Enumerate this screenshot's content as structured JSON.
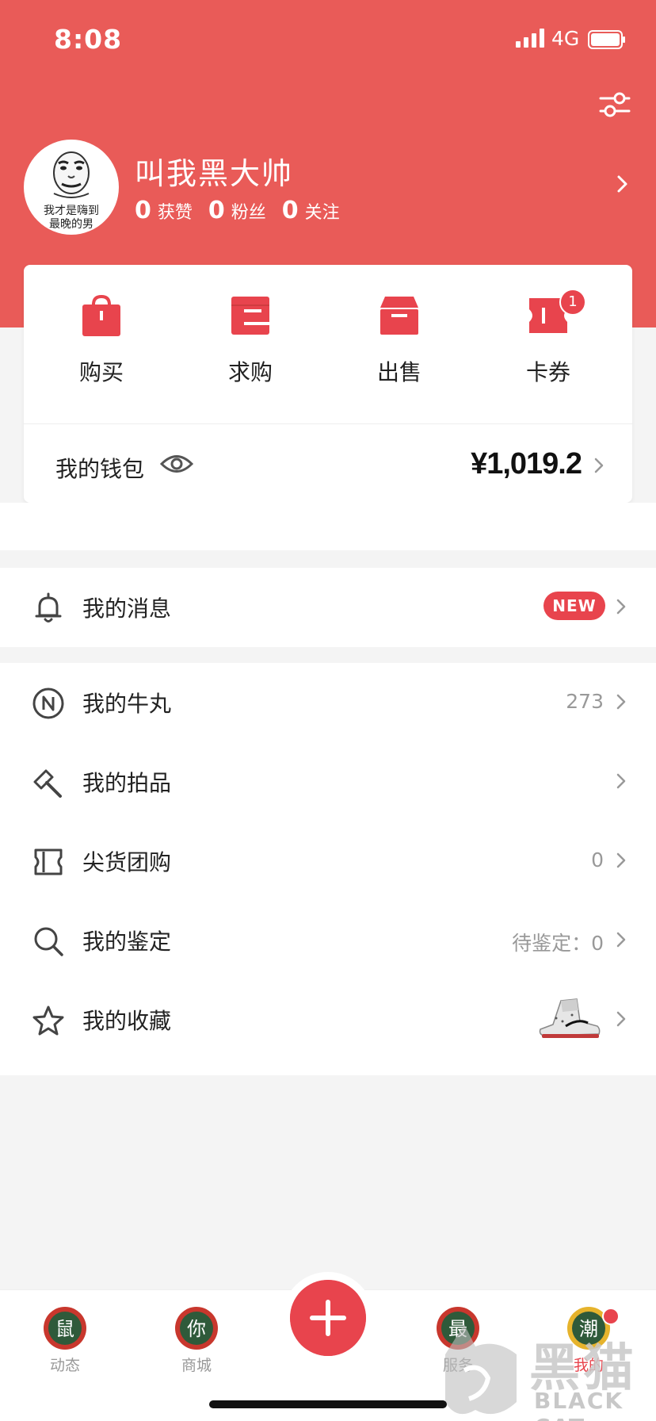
{
  "status_bar": {
    "time": "8:08",
    "network": "4G"
  },
  "profile": {
    "username": "叫我黑大帅",
    "avatar_caption_line1": "我才是嗨到",
    "avatar_caption_line2": "最晚的男",
    "stats": [
      {
        "num": "0",
        "label": "获赞"
      },
      {
        "num": "0",
        "label": "粉丝"
      },
      {
        "num": "0",
        "label": "关注"
      }
    ]
  },
  "quick_actions": [
    {
      "label": "购买",
      "icon": "shopping-bag-icon"
    },
    {
      "label": "求购",
      "icon": "wallet-icon"
    },
    {
      "label": "出售",
      "icon": "box-icon"
    },
    {
      "label": "卡券",
      "icon": "ticket-icon",
      "badge": "1"
    }
  ],
  "wallet": {
    "label": "我的钱包",
    "amount": "¥1,019.2"
  },
  "messages": {
    "label": "我的消息",
    "badge": "NEW"
  },
  "menu": [
    {
      "label": "我的牛丸",
      "icon": "n-coin-icon",
      "value": "273"
    },
    {
      "label": "我的拍品",
      "icon": "auction-hammer-icon",
      "value": ""
    },
    {
      "label": "尖货团购",
      "icon": "ticket-outline-icon",
      "value": "0"
    },
    {
      "label": "我的鉴定",
      "icon": "search-icon",
      "value": "待鉴定：0"
    },
    {
      "label": "我的收藏",
      "icon": "star-icon",
      "value": ""
    }
  ],
  "tabbar": [
    {
      "label": "动态",
      "glyph": "鼠",
      "color": "#c8372d"
    },
    {
      "label": "商城",
      "glyph": "你",
      "color": "#c8372d"
    },
    {
      "label": "服务",
      "glyph": "最",
      "color": "#c8372d"
    },
    {
      "label": "我的",
      "glyph": "潮",
      "color": "#e6b32c"
    }
  ],
  "watermark": {
    "cn": "黑猫",
    "en": "BLACK CAT"
  },
  "colors": {
    "brand_red": "#e95b58",
    "accent_red": "#e8444d"
  }
}
